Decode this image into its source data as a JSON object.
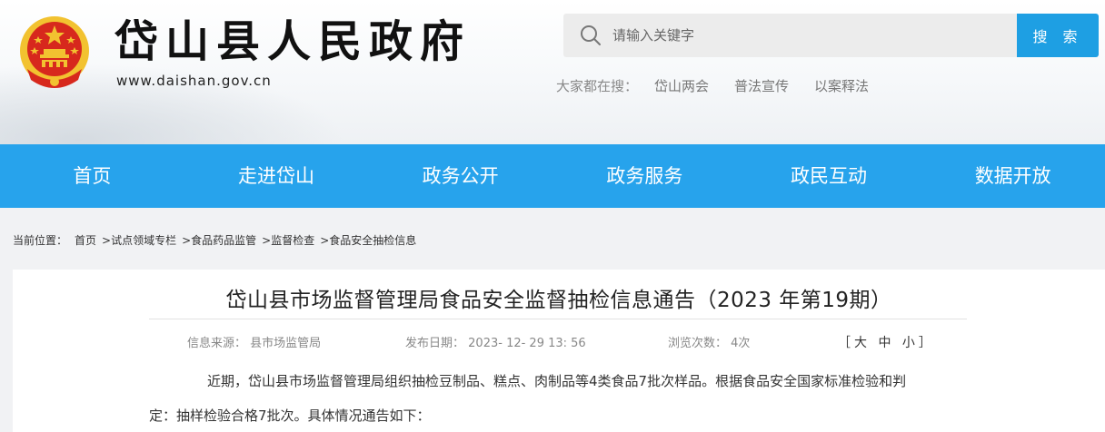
{
  "header": {
    "site_title": "岱山县人民政府",
    "site_url": "www.daishan.gov.cn",
    "search": {
      "placeholder": "请输入关键字",
      "button_label": "搜 索"
    },
    "hot_search": {
      "label": "大家都在搜：",
      "links": [
        "岱山两会",
        "普法宣传",
        "以案释法"
      ]
    }
  },
  "nav": {
    "items": [
      "首页",
      "走进岱山",
      "政务公开",
      "政务服务",
      "政民互动",
      "数据开放"
    ]
  },
  "breadcrumb": {
    "label": "当前位置：",
    "items": [
      "首页",
      ">试点领域专栏",
      ">食品药品监管",
      ">监督检查",
      ">食品安全抽检信息"
    ]
  },
  "article": {
    "title": "岱山县市场监督管理局食品安全监督抽检信息通告（2023 年第19期）",
    "source_label": "信息来源：",
    "source_value": "县市场监管局",
    "date_label": "发布日期：",
    "date_value": "2023- 12- 29 13: 56",
    "views_label": "浏览次数：",
    "views_value": "4次",
    "fontsize_open": "［",
    "fontsize_large": "大",
    "fontsize_medium": "中",
    "fontsize_small": "小",
    "fontsize_close": "］",
    "para_line1": "近期，岱山县市场监督管理局组织抽检豆制品、糕点、肉制品等4类食品7批次样品。根据食品安全国家标准检验和判",
    "para_line2": "定：抽样检验合格7批次。具体情况通告如下："
  },
  "colors": {
    "nav_bg": "#27a3ec",
    "search_button": "#1e9fe3",
    "emblem_red": "#d7281d",
    "emblem_gold": "#f2c230"
  }
}
